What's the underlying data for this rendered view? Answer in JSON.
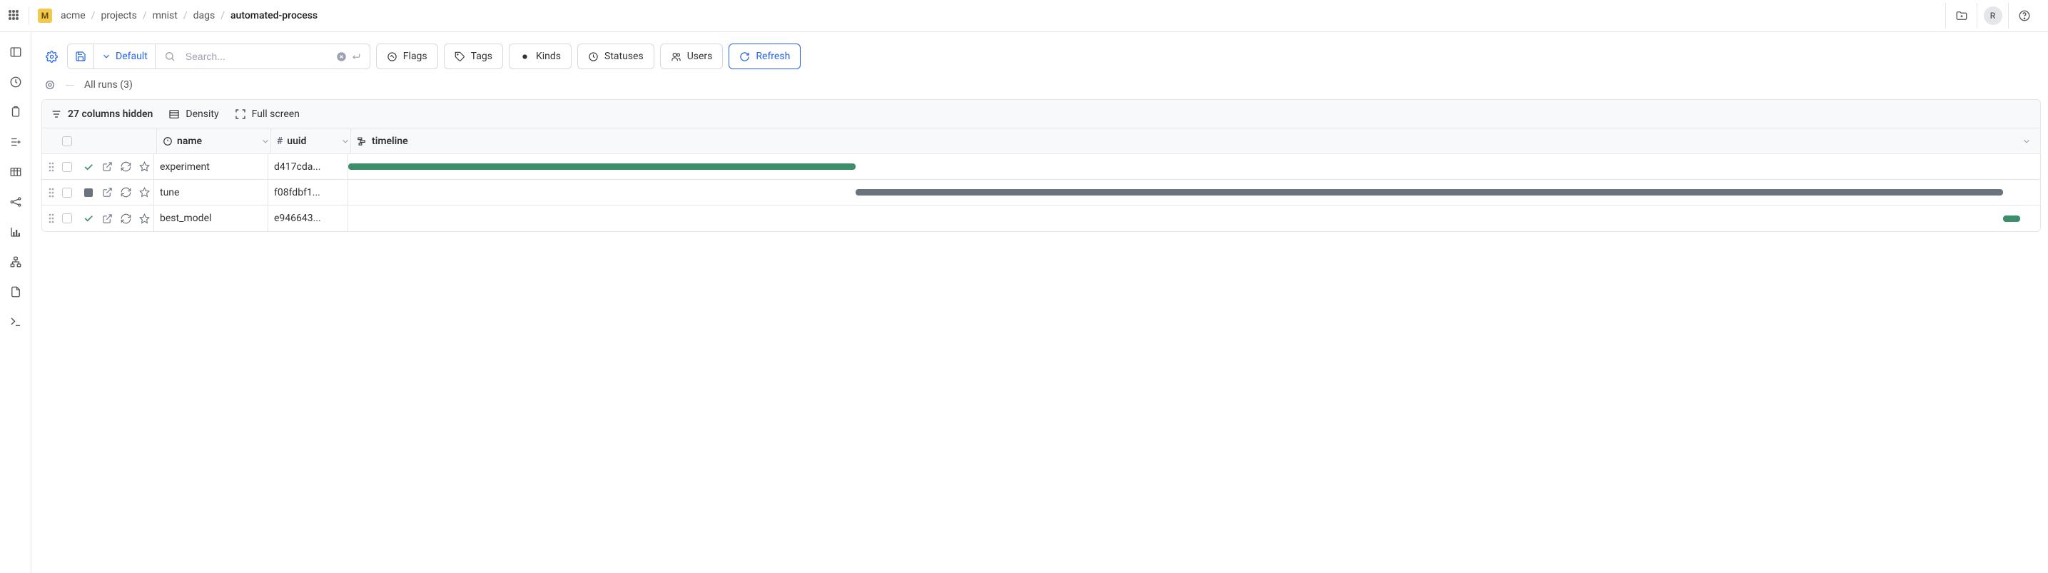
{
  "header": {
    "badge": "M",
    "avatar": "R"
  },
  "breadcrumbs": [
    "acme",
    "projects",
    "mnist",
    "dags",
    "automated-process"
  ],
  "toolbar": {
    "view_label": "Default",
    "search_placeholder": "Search...",
    "filters": {
      "flags": "Flags",
      "tags": "Tags",
      "kinds": "Kinds",
      "statuses": "Statuses",
      "users": "Users",
      "refresh": "Refresh"
    }
  },
  "subheader": {
    "all_runs": "All runs (3)"
  },
  "table_bar": {
    "hidden": "27 columns hidden",
    "density": "Density",
    "fullscreen": "Full screen"
  },
  "columns": {
    "name": "name",
    "uuid": "uuid",
    "timeline": "timeline"
  },
  "rows": [
    {
      "name": "experiment",
      "uuid": "d417cda...",
      "status": "done",
      "timeline": {
        "start": 0,
        "width": 30,
        "color": "green"
      }
    },
    {
      "name": "tune",
      "uuid": "f08fdbf1...",
      "status": "stopped",
      "timeline": {
        "start": 30,
        "width": 67.8,
        "color": "grey"
      }
    },
    {
      "name": "best_model",
      "uuid": "e946643...",
      "status": "done",
      "timeline": {
        "start": 97.8,
        "width": 1.0,
        "color": "green"
      }
    }
  ]
}
